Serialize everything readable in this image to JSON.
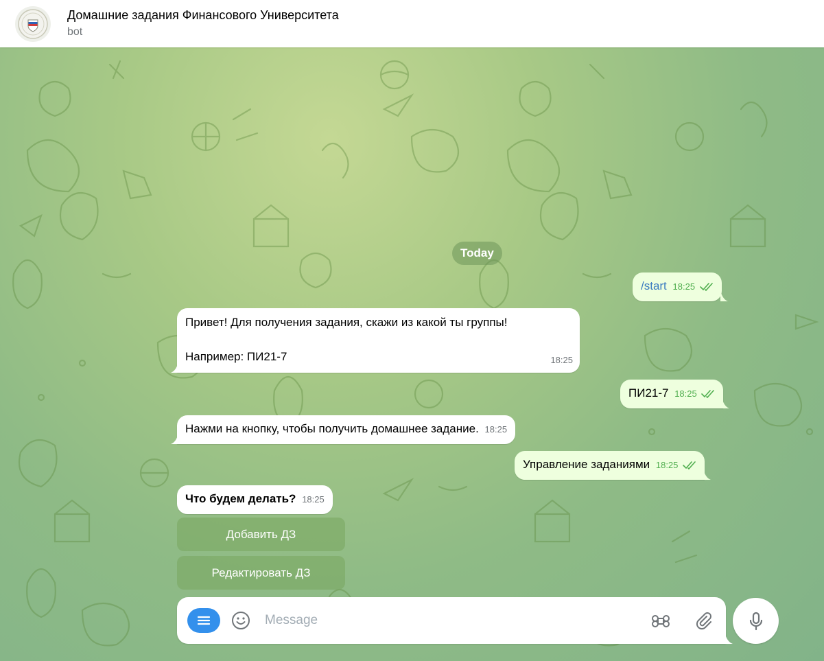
{
  "header": {
    "title": "Домашние задания Финансового Университета",
    "subtitle": "bot",
    "avatar_icon": "university-emblem-icon"
  },
  "date_separator": "Today",
  "messages": [
    {
      "direction": "outgoing",
      "text": "/start",
      "is_command": true,
      "time": "18:25",
      "status": "read"
    },
    {
      "direction": "incoming",
      "line1": "Привет! Для получения задания, скажи из какой ты группы!",
      "line2": "Например: ПИ21-7",
      "time": "18:25"
    },
    {
      "direction": "outgoing",
      "text": "ПИ21-7",
      "time": "18:25",
      "status": "read"
    },
    {
      "direction": "incoming",
      "text": "Нажми на кнопку, чтобы получить домашнее задание.",
      "time": "18:25"
    },
    {
      "direction": "outgoing",
      "text": "Управление заданиями",
      "time": "18:25",
      "status": "read"
    },
    {
      "direction": "incoming",
      "text": "Что будем делать?",
      "time": "18:25",
      "bold": true
    }
  ],
  "inline_keyboard": [
    {
      "label": "Добавить ДЗ"
    },
    {
      "label": "Редактировать ДЗ"
    }
  ],
  "composer": {
    "placeholder": "Message",
    "value": "",
    "menu_icon": "menu-icon",
    "emoji_icon": "smile-icon",
    "command_icon": "command-icon",
    "attach_icon": "paperclip-icon",
    "send_icon": "microphone-icon"
  },
  "colors": {
    "accent": "#3390ec",
    "outgoing_bubble": "#eeffde",
    "incoming_bubble": "#ffffff",
    "read_check": "#4fae4e",
    "time_gray": "#707579"
  }
}
